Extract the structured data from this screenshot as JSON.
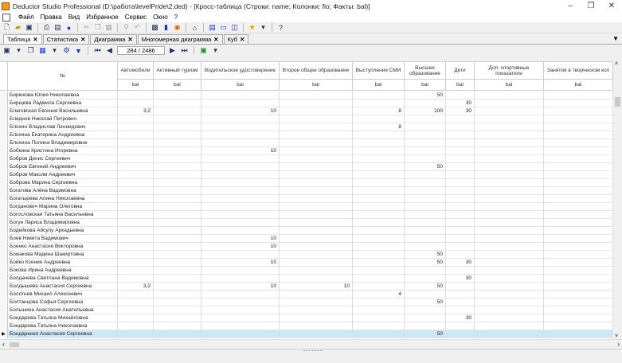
{
  "window": {
    "title": "Deductor Studio Professional (D:\\работа\\levelPride\\2.ded) - [Кросс-таблица (Строки: name; Колонки: fio; Факты: bal)]",
    "min": "–",
    "max": "❐",
    "close": "✕"
  },
  "menu": [
    "Файл",
    "Правка",
    "Вид",
    "Избранное",
    "Сервис",
    "Окно",
    "?"
  ],
  "tabs": [
    {
      "label": "Таблица",
      "active": true
    },
    {
      "label": "Статистика"
    },
    {
      "label": "Диаграмма"
    },
    {
      "label": "Многомерная диаграмма"
    },
    {
      "label": "Куб"
    }
  ],
  "nav": {
    "counter": "284 / 2486"
  },
  "grid": {
    "name_header": "№",
    "columns": [
      {
        "title": "Автомобили",
        "fact": "bal"
      },
      {
        "title": "Активный туризм",
        "fact": "bal"
      },
      {
        "title": "Водительское удостоверение",
        "fact": "bal"
      },
      {
        "title": "Второе общее образование",
        "fact": "bal"
      },
      {
        "title": "Выступления СМИ",
        "fact": "bal"
      },
      {
        "title": "Высшее образование",
        "fact": "bal"
      },
      {
        "title": "Дети",
        "fact": "bal"
      },
      {
        "title": "Доп. спортивные показатели",
        "fact": "bal"
      },
      {
        "title": "Занятия в творческом кол",
        "fact": "bal"
      }
    ],
    "rows": [
      [
        "Бирюкова Юлия Николаевна",
        "",
        "",
        "",
        "",
        "",
        "50",
        "",
        "",
        ""
      ],
      [
        "Бирщева Радмила Сергеевна",
        "",
        "",
        "",
        "",
        "",
        "",
        "30",
        "",
        ""
      ],
      [
        "Благовская Евгения Васильевна",
        "3,2",
        "",
        "10",
        "",
        "8",
        "100",
        "30",
        "",
        ""
      ],
      [
        "Бледнов Николай Петрович",
        "",
        "",
        "",
        "",
        "",
        "",
        "",
        "",
        ""
      ],
      [
        "Блохин Владислав Леонидович",
        "",
        "",
        "",
        "",
        "8",
        "",
        "",
        "",
        ""
      ],
      [
        "Блохина Екатерина Андреевна",
        "",
        "",
        "",
        "",
        "",
        "",
        "",
        "",
        ""
      ],
      [
        "Блохина Полина Владимировна",
        "",
        "",
        "",
        "",
        "",
        "",
        "",
        "",
        ""
      ],
      [
        "Бобкина Кристина Игоревна",
        "",
        "",
        "10",
        "",
        "",
        "",
        "",
        "",
        ""
      ],
      [
        "Бобров Денис Сергеевич",
        "",
        "",
        "",
        "",
        "",
        "",
        "",
        "",
        ""
      ],
      [
        "Бобров Евгений Андреевич",
        "",
        "",
        "",
        "",
        "",
        "50",
        "",
        "",
        ""
      ],
      [
        "Бобров Максим Андреевич",
        "",
        "",
        "",
        "",
        "",
        "",
        "",
        "",
        ""
      ],
      [
        "Боброва Марина Сергеевна",
        "",
        "",
        "",
        "",
        "",
        "",
        "",
        "",
        ""
      ],
      [
        "Богатова Алёна Вадимовна",
        "",
        "",
        "",
        "",
        "",
        "",
        "",
        "",
        ""
      ],
      [
        "Богатырева Алина Николаевна",
        "",
        "",
        "",
        "",
        "",
        "",
        "",
        "",
        ""
      ],
      [
        "Богданович Марина Олеговна",
        "",
        "",
        "",
        "",
        "",
        "",
        "",
        "",
        ""
      ],
      [
        "Богословская Татьяна Васильевна",
        "",
        "",
        "",
        "",
        "",
        "",
        "",
        "",
        ""
      ],
      [
        "Богун Лариса Владимировна",
        "",
        "",
        "",
        "",
        "",
        "",
        "",
        "",
        ""
      ],
      [
        "Бодейкова Айсулу Аркадьевна",
        "",
        "",
        "",
        "",
        "",
        "",
        "",
        "",
        ""
      ],
      [
        "Боев Никита  Вадимович",
        "",
        "",
        "10",
        "",
        "",
        "",
        "",
        "",
        ""
      ],
      [
        "Боенко Анастасия Викторовна",
        "",
        "",
        "10",
        "",
        "",
        "",
        "",
        "",
        ""
      ],
      [
        "Божакова Мадина Шакиртовна",
        "",
        "",
        "",
        "",
        "",
        "50",
        "",
        "",
        ""
      ],
      [
        "Бойко Ксения Андреевна",
        "",
        "",
        "10",
        "",
        "",
        "50",
        "30",
        "",
        ""
      ],
      [
        "Бокова Ирина Андреевна",
        "",
        "",
        "",
        "",
        "",
        "",
        "",
        "",
        ""
      ],
      [
        "Болдачева Светлана Вадимовна",
        "",
        "",
        "",
        "",
        "",
        "",
        "30",
        "",
        ""
      ],
      [
        "Болдышева  Анастасия Сергеевна",
        "3,2",
        "",
        "10",
        "10",
        "",
        "50",
        "",
        "",
        ""
      ],
      [
        "Болотнев Михаил Алексеевич",
        "",
        "",
        "",
        "",
        "4",
        "",
        "",
        "",
        ""
      ],
      [
        "Болтанцова Софья Сергеевна",
        "",
        "",
        "",
        "",
        "",
        "50",
        "",
        "",
        ""
      ],
      [
        "Большина Анастасия Анатольевна",
        "",
        "",
        "",
        "",
        "",
        "",
        "",
        "",
        ""
      ],
      [
        "Бондарева Татьяна Михайловна",
        "",
        "",
        "",
        "",
        "",
        "",
        "30",
        "",
        ""
      ],
      [
        "Бондарева Татьяна Николаевна",
        "",
        "",
        "",
        "",
        "",
        "",
        "",
        "",
        ""
      ],
      [
        "Бондаренко Анастасия Сергеевна",
        "",
        "",
        "",
        "",
        "",
        "50",
        "",
        "",
        ""
      ]
    ],
    "selected_row": 30
  }
}
